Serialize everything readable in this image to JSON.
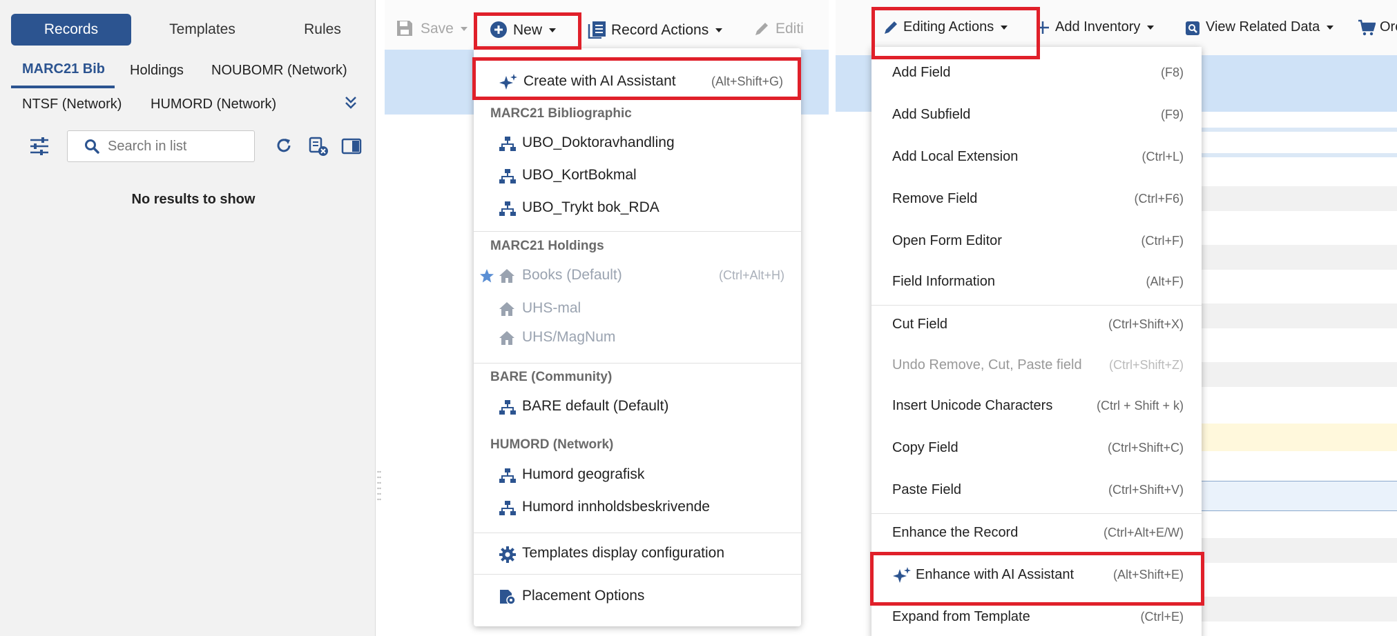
{
  "left": {
    "top_tabs": [
      "Records",
      "Templates",
      "Rules"
    ],
    "sub_tabs": [
      "MARC21 Bib",
      "Holdings",
      "NOUBOMR (Network)",
      "NTSF (Network)",
      "HUMORD (Network)"
    ],
    "search_placeholder": "Search in list",
    "no_results": "No results to show",
    "toolbar": {
      "save": "Save",
      "new": "New",
      "record_actions": "Record Actions",
      "editing_truncated": "Editi"
    },
    "new_menu": {
      "ai_item": {
        "label": "Create with AI Assistant",
        "shortcut": "(Alt+Shift+G)"
      },
      "group1_header": "MARC21 Bibliographic",
      "group1_items": [
        "UBO_Doktoravhandling",
        "UBO_KortBokmal",
        "UBO_Trykt bok_RDA"
      ],
      "group2_header": "MARC21 Holdings",
      "group2_items": [
        {
          "label": "Books (Default)",
          "shortcut": "(Ctrl+Alt+H)"
        },
        {
          "label": "UHS-mal"
        },
        {
          "label": "UHS/MagNum"
        }
      ],
      "group3_header": "BARE (Community)",
      "group3_items": [
        "BARE default (Default)"
      ],
      "group4_header": "HUMORD (Network)",
      "group4_items": [
        "Humord geografisk",
        "Humord innholdsbeskrivende"
      ],
      "config_item": "Templates display configuration",
      "placement_item": "Placement Options"
    }
  },
  "right": {
    "toolbar": {
      "editing_actions": "Editing Actions",
      "add_inventory": "Add Inventory",
      "view_related": "View Related Data",
      "order_truncated": "Orc"
    },
    "menu": [
      {
        "label": "Add Field",
        "shortcut": "(F8)"
      },
      {
        "label": "Add Subfield",
        "shortcut": "(F9)"
      },
      {
        "label": "Add Local Extension",
        "shortcut": "(Ctrl+L)"
      },
      {
        "label": "Remove Field",
        "shortcut": "(Ctrl+F6)"
      },
      {
        "label": "Open Form Editor",
        "shortcut": "(Ctrl+F)"
      },
      {
        "label": "Field Information",
        "shortcut": "(Alt+F)"
      },
      {
        "label": "Cut Field",
        "shortcut": "(Ctrl+Shift+X)"
      },
      {
        "label": "Undo Remove, Cut, Paste field",
        "shortcut": "(Ctrl+Shift+Z)"
      },
      {
        "label": "Insert Unicode Characters",
        "shortcut": "(Ctrl + Shift + k)"
      },
      {
        "label": "Copy Field",
        "shortcut": "(Ctrl+Shift+C)"
      },
      {
        "label": "Paste Field",
        "shortcut": "(Ctrl+Shift+V)"
      },
      {
        "label": "Enhance the Record",
        "shortcut": "(Ctrl+Alt+E/W)"
      },
      {
        "label": "Enhance with AI Assistant",
        "shortcut": "(Alt+Shift+E)"
      },
      {
        "label": "Expand from Template",
        "shortcut": "(Ctrl+E)"
      }
    ]
  },
  "colors": {
    "brand_blue": "#2c5490",
    "highlight_red": "#e0202a",
    "band_blue": "#cfe2f7",
    "dim_text": "#9aa3b0"
  },
  "icons": {
    "filter": "filter-sliders-icon",
    "search": "search-icon",
    "refresh": "refresh-icon",
    "clear_list": "clear-list-icon",
    "panel_toggle": "panel-toggle-icon",
    "expand_more": "double-chevron-down-icon",
    "save": "save-icon",
    "new": "plus-circle-icon",
    "record_actions": "record-actions-icon",
    "edit": "pencil-icon",
    "ai": "sparkles-icon",
    "template": "hierarchy-icon",
    "holdings_template": "house-icon",
    "default_star": "star-icon",
    "config": "gear-icon",
    "placement": "placement-icon",
    "add": "plus-icon",
    "view_related": "view-related-icon",
    "cart": "cart-icon"
  }
}
